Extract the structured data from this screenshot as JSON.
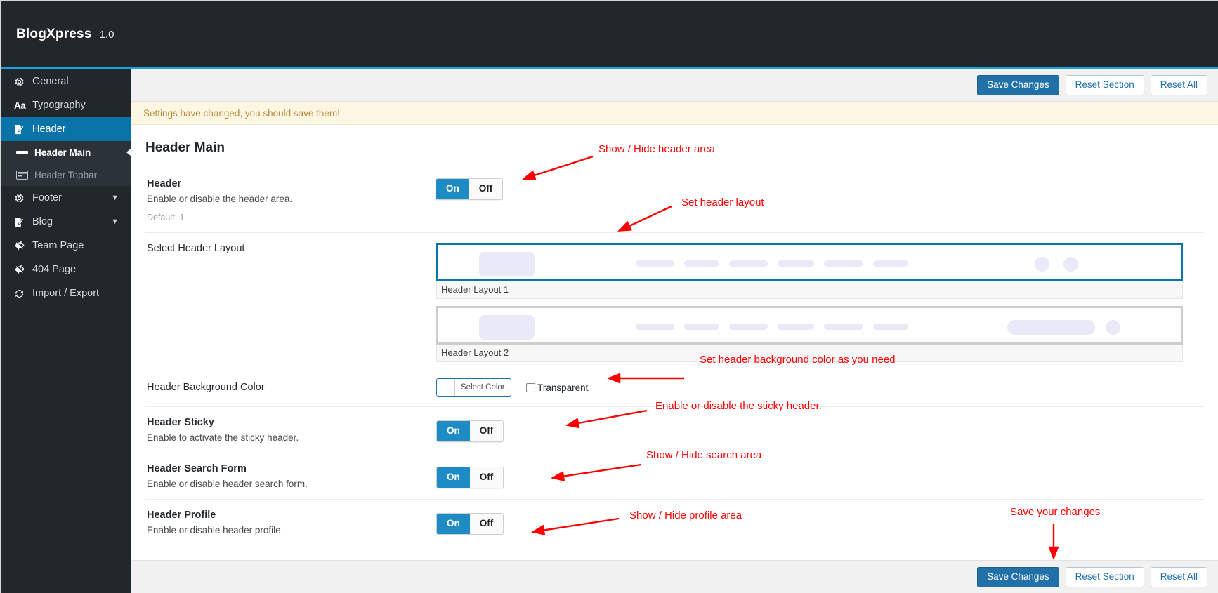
{
  "brand": {
    "name": "BlogXpress",
    "version": "1.0"
  },
  "sidebar": {
    "items": [
      {
        "label": "General",
        "icon": "gear-icon",
        "level": "top",
        "state": "normal",
        "chevron": ""
      },
      {
        "label": "Typography",
        "icon": "typography-icon",
        "level": "top",
        "state": "normal",
        "chevron": ""
      },
      {
        "label": "Header",
        "icon": "pencil-doc-icon",
        "level": "top",
        "state": "active",
        "chevron": ""
      },
      {
        "label": "Header Main",
        "icon": "bar-icon",
        "level": "sub",
        "state": "current",
        "chevron": ""
      },
      {
        "label": "Header Topbar",
        "icon": "topbar-icon",
        "level": "sub",
        "state": "dim",
        "chevron": ""
      },
      {
        "label": "Footer",
        "icon": "gear-icon",
        "level": "top",
        "state": "normal",
        "chevron": "chevron-down-icon"
      },
      {
        "label": "Blog",
        "icon": "pencil-doc-icon",
        "level": "top",
        "state": "normal",
        "chevron": "chevron-down-icon"
      },
      {
        "label": "Team Page",
        "icon": "eye-slash-icon",
        "level": "top",
        "state": "normal",
        "chevron": ""
      },
      {
        "label": "404 Page",
        "icon": "eye-slash-icon",
        "level": "top",
        "state": "normal",
        "chevron": ""
      },
      {
        "label": "Import / Export",
        "icon": "refresh-icon",
        "level": "top",
        "state": "normal",
        "chevron": ""
      }
    ]
  },
  "toolbar": {
    "save_label": "Save Changes",
    "reset_section_label": "Reset Section",
    "reset_all_label": "Reset All"
  },
  "notice": {
    "text": "Settings have changed, you should save them!"
  },
  "panel": {
    "title": "Header Main"
  },
  "rows": {
    "header": {
      "title": "Header",
      "desc": "Enable or disable the header area.",
      "default": "Default: 1",
      "on": "On",
      "off": "Off",
      "value": "On"
    },
    "layout": {
      "title": "Select Header Layout",
      "options": [
        {
          "caption": "Header Layout 1",
          "selected": true
        },
        {
          "caption": "Header Layout 2",
          "selected": false
        }
      ]
    },
    "bgcolor": {
      "title": "Header Background Color",
      "select_color_label": "Select Color",
      "swatch_color": "#ffffff",
      "transparent_label": "Transparent",
      "transparent_checked": false
    },
    "sticky": {
      "title": "Header Sticky",
      "desc": "Enable to activate the sticky header.",
      "on": "On",
      "off": "Off",
      "value": "On"
    },
    "search": {
      "title": "Header Search Form",
      "desc": "Enable or disable header search form.",
      "on": "On",
      "off": "Off",
      "value": "On"
    },
    "profile": {
      "title": "Header Profile",
      "desc": "Enable or disable header profile.",
      "on": "On",
      "off": "Off",
      "value": "On"
    }
  },
  "annotations": [
    {
      "text": "Show / Hide header area"
    },
    {
      "text": "Set header layout"
    },
    {
      "text": "Set header background color as you need"
    },
    {
      "text": "Enable or disable the sticky header."
    },
    {
      "text": "Show / Hide search area"
    },
    {
      "text": "Show / Hide profile area"
    },
    {
      "text": "Save your changes"
    }
  ],
  "colors": {
    "brand_bar": "#22272b",
    "accent_rule": "#1aa3dd",
    "sidebar_active": "#0a74a8",
    "toggle_on": "#1e8cc4",
    "primary_button": "#2171a8",
    "notice_bg": "#fcf6e3",
    "notice_text": "#b58b36",
    "annotation": "#ff0000",
    "layout_placeholder": "#e9e9f7"
  }
}
